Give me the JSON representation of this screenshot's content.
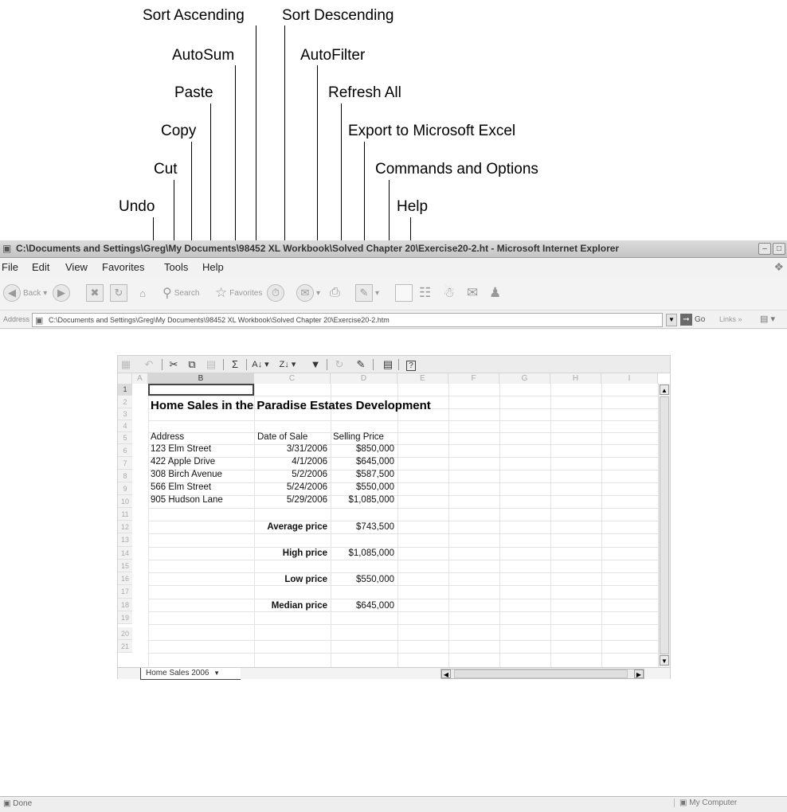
{
  "callouts": {
    "sort_ascending": "Sort Ascending",
    "sort_descending": "Sort Descending",
    "autosum": "AutoSum",
    "autofilter": "AutoFilter",
    "paste": "Paste",
    "refresh_all": "Refresh All",
    "copy": "Copy",
    "export_excel": "Export to Microsoft Excel",
    "cut": "Cut",
    "commands_options": "Commands and Options",
    "undo": "Undo",
    "help": "Help"
  },
  "window": {
    "title": "C:\\Documents and Settings\\Greg\\My Documents\\98452 XL Workbook\\Solved Chapter 20\\Exercise20-2.ht - Microsoft Internet Explorer",
    "menu": [
      "File",
      "Edit",
      "View",
      "Favorites",
      "Tools",
      "Help"
    ],
    "toolbar": {
      "back": "Back",
      "search": "Search",
      "favorites": "Favorites"
    },
    "address_label": "Address",
    "address_value": "C:\\Documents and Settings\\Greg\\My Documents\\98452 XL Workbook\\Solved Chapter 20\\Exercise20-2.htm",
    "go_label": "Go",
    "links_label": "Links",
    "status_text": "Done",
    "zone_text": "My Computer"
  },
  "sheet": {
    "columns": [
      "A",
      "B",
      "C",
      "D",
      "E",
      "F",
      "G",
      "H",
      "I"
    ],
    "row_numbers": [
      "1",
      "2",
      "3",
      "4",
      "5",
      "6",
      "7",
      "8",
      "9",
      "10",
      "11",
      "12",
      "13",
      "14",
      "15",
      "16",
      "17",
      "18",
      "19",
      "20",
      "21"
    ],
    "title": "Home Sales in the Paradise Estates Development",
    "headers": {
      "address": "Address",
      "date": "Date of Sale",
      "price": "Selling Price"
    },
    "rows": [
      {
        "address": "123 Elm Street",
        "date": "3/31/2006",
        "price": "$850,000"
      },
      {
        "address": "422 Apple Drive",
        "date": "4/1/2006",
        "price": "$645,000"
      },
      {
        "address": "308 Birch Avenue",
        "date": "5/2/2006",
        "price": "$587,500"
      },
      {
        "address": "566 Elm Street",
        "date": "5/24/2006",
        "price": "$550,000"
      },
      {
        "address": "905 Hudson Lane",
        "date": "5/29/2006",
        "price": "$1,085,000"
      }
    ],
    "stats": {
      "avg_label": "Average price",
      "avg_value": "$743,500",
      "high_label": "High price",
      "high_value": "$1,085,000",
      "low_label": "Low price",
      "low_value": "$550,000",
      "median_label": "Median price",
      "median_value": "$645,000"
    },
    "tab_name": "Home Sales 2006"
  }
}
